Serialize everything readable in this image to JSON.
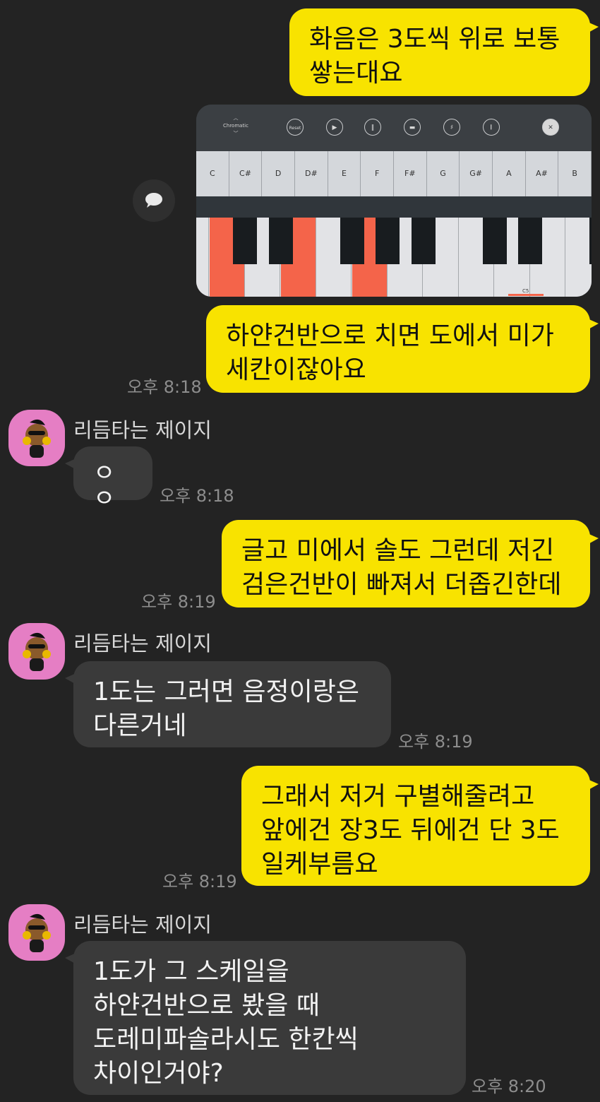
{
  "messages": [
    {
      "text": "화음은 3도씩 위로 보통\n쌓는대요",
      "time": ""
    },
    {
      "text": "하얀건반으로 치면 도에서 미가\n세칸이잖아요",
      "time": "오후 8:18"
    },
    {
      "text": "ㅇㅇ",
      "time": "오후 8:18"
    },
    {
      "text": "글고 미에서 솔도 그런데 저긴\n검은건반이 빠져서 더좁긴한데",
      "time": "오후 8:19"
    },
    {
      "text": "1도는 그러면 음정이랑은\n다른거네",
      "time": "오후 8:19"
    },
    {
      "text": "그래서 저거 구별해줄려고\n앞에건 장3도 뒤에건 단 3도\n일케부름요",
      "time": "오후 8:19"
    },
    {
      "text": "1도가 그 스케일을\n하얀건반으로 봤을 때\n도레미파솔라시도 한칸씩\n차이인거야?",
      "time": "오후 8:20"
    }
  ],
  "sender_name": "리듬타는 제이지",
  "piano": {
    "mode_label": "Chromatic",
    "reset_label": "Reset",
    "note_labels": [
      "C",
      "C#",
      "D",
      "D#",
      "E",
      "F",
      "F#",
      "G",
      "G#",
      "A",
      "A#",
      "B"
    ],
    "octave_label": "C5",
    "highlighted_keys": [
      "C",
      "E",
      "G"
    ]
  },
  "colors": {
    "background": "#232323",
    "my_bubble": "#f8e300",
    "their_bubble": "#3a3a3a",
    "highlight": "#f4644a"
  }
}
